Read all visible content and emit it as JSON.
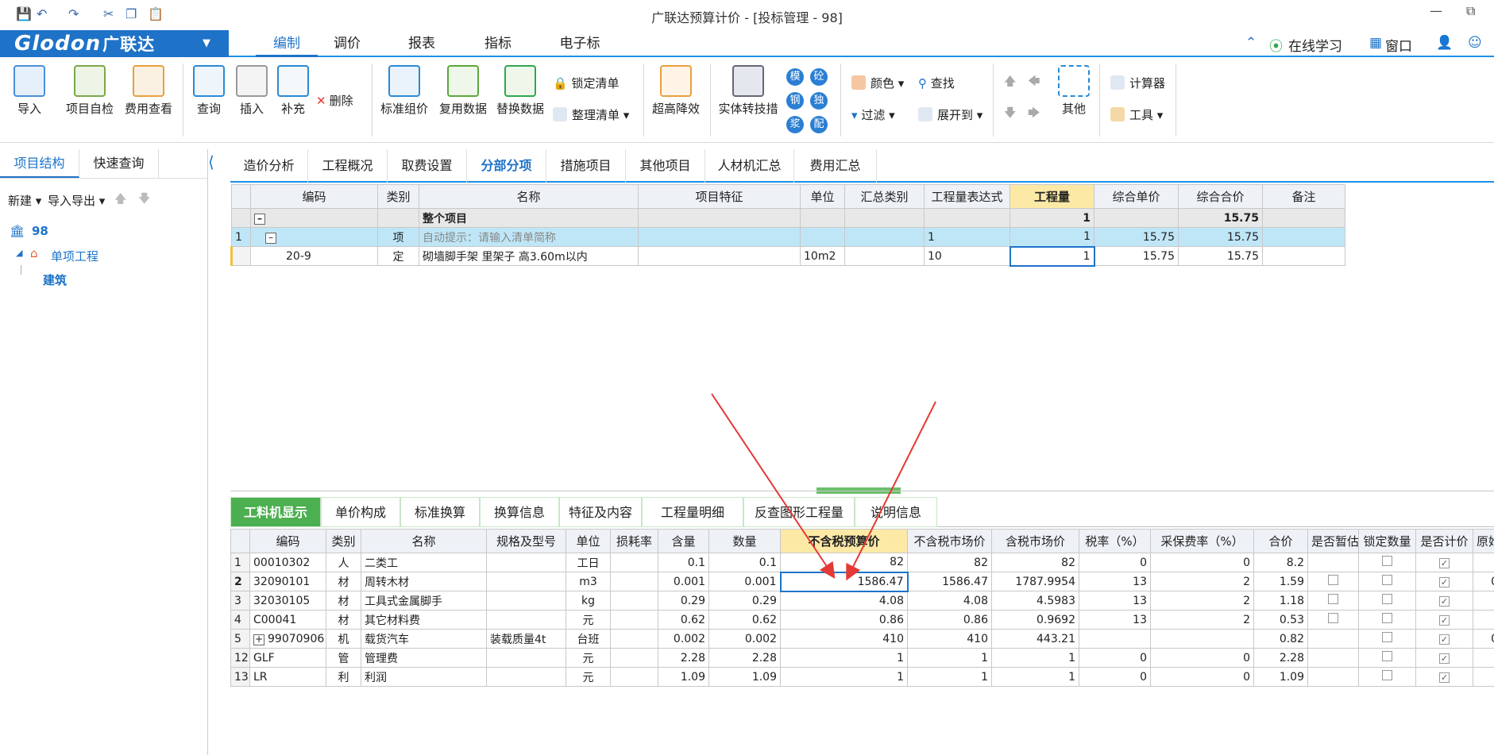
{
  "window": {
    "title": "广联达预算计价 - [投标管理 - 98]"
  },
  "menu": {
    "logo_text": "Glodon",
    "logo_cn": "广联达",
    "tabs": [
      "编制",
      "调价",
      "报表",
      "指标",
      "电子标"
    ],
    "active_tab": "编制",
    "online_learning": "在线学习",
    "window_menu": "窗口"
  },
  "ribbon": {
    "import": "导入",
    "self_check": "项目自检",
    "fee_view": "费用查看",
    "query": "查询",
    "insert": "插入",
    "supplement": "补充",
    "delete": "删除",
    "std_group": "标准组价",
    "reuse_data": "复用数据",
    "replace_data": "替换数据",
    "lock_list": "锁定清单",
    "arrange_list": "整理清单",
    "height_reduce": "超高降效",
    "entity_convert": "实体转技措",
    "color": "颜色",
    "find": "查找",
    "filter": "过滤",
    "expand_to": "展开到",
    "other": "其他",
    "calculator": "计算器",
    "tools": "工具",
    "circles": [
      "模",
      "砼",
      "钢",
      "独",
      "浆",
      "配"
    ]
  },
  "left": {
    "tabs": [
      "项目结构",
      "快速查询"
    ],
    "new": "新建",
    "import_export": "导入导出",
    "tree": {
      "root": "98",
      "unit": "单项工程",
      "leaf": "建筑"
    }
  },
  "top_tabs": [
    "造价分析",
    "工程概况",
    "取费设置",
    "分部分项",
    "措施项目",
    "其他项目",
    "人材机汇总",
    "费用汇总"
  ],
  "top_table": {
    "headers": [
      "编码",
      "类别",
      "名称",
      "项目特征",
      "单位",
      "汇总类别",
      "工程量表达式",
      "工程量",
      "综合单价",
      "综合合价",
      "备注"
    ],
    "whole": {
      "name": "整个项目",
      "qty": "1",
      "total": "15.75"
    },
    "rows": [
      {
        "no": "1",
        "code": "",
        "type": "项",
        "name": "自动提示：请输入清单简称",
        "feature": "",
        "unit": "",
        "sum": "",
        "expr": "1",
        "qty": "1",
        "price": "15.75",
        "total": "15.75"
      },
      {
        "no": "",
        "code": "20-9",
        "type": "定",
        "name": "砌墙脚手架 里架子 高3.60m以内",
        "feature": "",
        "unit": "10m2",
        "sum": "",
        "expr": "10",
        "qty": "1",
        "price": "15.75",
        "total": "15.75"
      }
    ]
  },
  "bottom_tabs": [
    "工料机显示",
    "单价构成",
    "标准换算",
    "换算信息",
    "特征及内容",
    "工程量明细",
    "反查图形工程量",
    "说明信息"
  ],
  "bottom_table": {
    "headers": [
      "编码",
      "类别",
      "名称",
      "规格及型号",
      "单位",
      "损耗率",
      "含量",
      "数量",
      "不含税预算价",
      "不含税市场价",
      "含税市场价",
      "税率（%）",
      "采保费率（%）",
      "合价",
      "是否暂估",
      "锁定数量",
      "是否计价",
      "原始含"
    ],
    "rows": [
      {
        "no": "1",
        "code": "00010302",
        "type": "人",
        "name": "二类工",
        "spec": "",
        "unit": "工日",
        "loss": "",
        "content": "0.1",
        "qty": "0.1",
        "budget": "82",
        "market": "82",
        "tax_market": "82",
        "tax": "0",
        "fee": "0",
        "total": "8.2",
        "est": false,
        "lock": true,
        "calc": true,
        "orig": ""
      },
      {
        "no": "2",
        "code": "32090101",
        "type": "材",
        "name": "周转木材",
        "spec": "",
        "unit": "m3",
        "loss": "",
        "content": "0.001",
        "qty": "0.001",
        "budget": "1586.47",
        "market": "1586.47",
        "tax_market": "1787.9954",
        "tax": "13",
        "fee": "2",
        "total": "1.59",
        "est": true,
        "lock": true,
        "calc": true,
        "orig": "0"
      },
      {
        "no": "3",
        "code": "32030105",
        "type": "材",
        "name": "工具式金属脚手",
        "spec": "",
        "unit": "kg",
        "loss": "",
        "content": "0.29",
        "qty": "0.29",
        "budget": "4.08",
        "market": "4.08",
        "tax_market": "4.5983",
        "tax": "13",
        "fee": "2",
        "total": "1.18",
        "est": true,
        "lock": true,
        "calc": true,
        "orig": ""
      },
      {
        "no": "4",
        "code": "C00041",
        "type": "材",
        "name": "其它材料费",
        "spec": "",
        "unit": "元",
        "loss": "",
        "content": "0.62",
        "qty": "0.62",
        "budget": "0.86",
        "market": "0.86",
        "tax_market": "0.9692",
        "tax": "13",
        "fee": "2",
        "total": "0.53",
        "est": true,
        "lock": true,
        "calc": true,
        "orig": ""
      },
      {
        "no": "5",
        "code": "99070906",
        "type": "机",
        "name": "载货汽车",
        "spec": "装载质量4t",
        "unit": "台班",
        "loss": "",
        "content": "0.002",
        "qty": "0.002",
        "budget": "410",
        "market": "410",
        "tax_market": "443.21",
        "tax": "",
        "fee": "",
        "total": "0.82",
        "est": false,
        "lock": true,
        "calc": true,
        "orig": "0"
      },
      {
        "no": "12",
        "code": "GLF",
        "type": "管",
        "name": "管理费",
        "spec": "",
        "unit": "元",
        "loss": "",
        "content": "2.28",
        "qty": "2.28",
        "budget": "1",
        "market": "1",
        "tax_market": "1",
        "tax": "0",
        "fee": "0",
        "total": "2.28",
        "est": false,
        "lock": true,
        "calc": true,
        "orig": ""
      },
      {
        "no": "13",
        "code": "LR",
        "type": "利",
        "name": "利润",
        "spec": "",
        "unit": "元",
        "loss": "",
        "content": "1.09",
        "qty": "1.09",
        "budget": "1",
        "market": "1",
        "tax_market": "1",
        "tax": "0",
        "fee": "0",
        "total": "1.09",
        "est": false,
        "lock": true,
        "calc": true,
        "orig": ""
      }
    ]
  },
  "colors": {
    "accent": "#1e73c8",
    "arrow": "#e53935",
    "green": "#4caf50"
  }
}
